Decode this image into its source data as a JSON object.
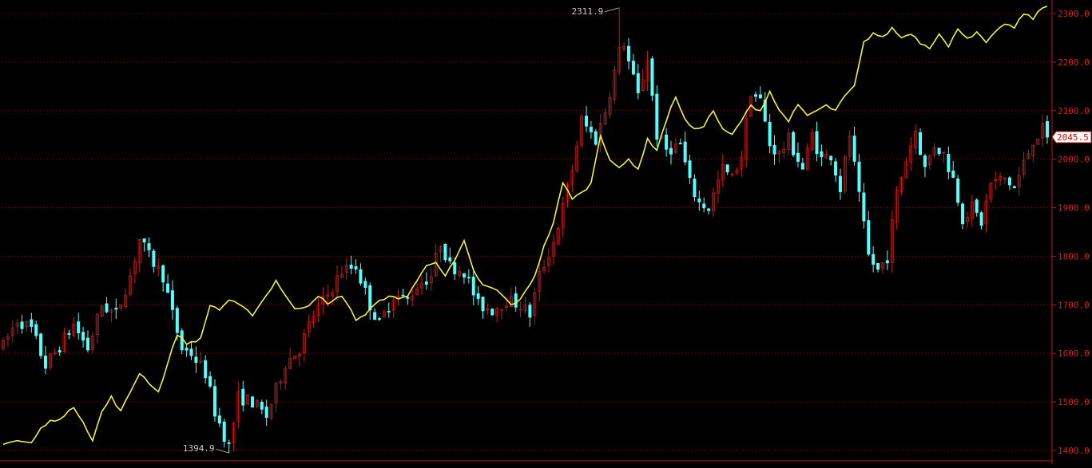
{
  "theme": {
    "background": "#000000",
    "grid_color": "#7a0f0f",
    "axis_color": "#c01515",
    "axis_text_color": "#d02020",
    "up_color": "#c01a1a",
    "down_color": "#54ffff",
    "line_color": "#f2f240",
    "label_color": "#c8c8c8",
    "current_box_bg": "#ffffff",
    "current_box_text": "#e00000"
  },
  "chart_data": {
    "type": "candlestick",
    "title": "",
    "ylim": [
      1385,
      2330
    ],
    "y_ticks": [
      {
        "value": 2300,
        "label": "2300.0"
      },
      {
        "value": 2200,
        "label": "2200.0"
      },
      {
        "value": 2100,
        "label": "2100.0"
      },
      {
        "value": 2000,
        "label": "2000.0"
      },
      {
        "value": 1900,
        "label": "1900.0"
      },
      {
        "value": 1800,
        "label": "1800.0"
      },
      {
        "value": 1700,
        "label": "1700.0"
      },
      {
        "value": 1600,
        "label": "1600.0"
      },
      {
        "value": 1500,
        "label": "1500.0"
      },
      {
        "value": 1400,
        "label": "1400.0"
      }
    ],
    "grid": true,
    "current_value": {
      "value": 2045.5,
      "label": "2045.5"
    },
    "max_annotation": {
      "label": "2311.9",
      "value": 2311.9,
      "bar_index": 131
    },
    "min_annotation": {
      "label": "1394.9",
      "value": 1394.9,
      "bar_index": 48
    },
    "price_keyframes": [
      [
        0,
        1615
      ],
      [
        3,
        1670
      ],
      [
        6,
        1650
      ],
      [
        9,
        1575
      ],
      [
        12,
        1615
      ],
      [
        15,
        1660
      ],
      [
        18,
        1610
      ],
      [
        21,
        1700
      ],
      [
        24,
        1680
      ],
      [
        27,
        1760
      ],
      [
        29,
        1835
      ],
      [
        31,
        1800
      ],
      [
        34,
        1760
      ],
      [
        36,
        1680
      ],
      [
        38,
        1610
      ],
      [
        40,
        1600
      ],
      [
        43,
        1560
      ],
      [
        45,
        1480
      ],
      [
        48,
        1408
      ],
      [
        50,
        1510
      ],
      [
        53,
        1500
      ],
      [
        56,
        1470
      ],
      [
        60,
        1580
      ],
      [
        63,
        1610
      ],
      [
        66,
        1680
      ],
      [
        69,
        1720
      ],
      [
        72,
        1770
      ],
      [
        75,
        1780
      ],
      [
        78,
        1700
      ],
      [
        80,
        1660
      ],
      [
        83,
        1720
      ],
      [
        86,
        1710
      ],
      [
        88,
        1740
      ],
      [
        91,
        1760
      ],
      [
        93,
        1830
      ],
      [
        95,
        1780
      ],
      [
        98,
        1770
      ],
      [
        101,
        1700
      ],
      [
        104,
        1690
      ],
      [
        107,
        1710
      ],
      [
        110,
        1700
      ],
      [
        112,
        1680
      ],
      [
        114,
        1760
      ],
      [
        117,
        1830
      ],
      [
        119,
        1900
      ],
      [
        121,
        1980
      ],
      [
        123,
        2080
      ],
      [
        126,
        2040
      ],
      [
        128,
        2100
      ],
      [
        130,
        2180
      ],
      [
        131,
        2280
      ],
      [
        133,
        2200
      ],
      [
        135,
        2130
      ],
      [
        137,
        2210
      ],
      [
        139,
        2050
      ],
      [
        141,
        2020
      ],
      [
        144,
        2030
      ],
      [
        146,
        1950
      ],
      [
        148,
        1910
      ],
      [
        150,
        1900
      ],
      [
        153,
        1980
      ],
      [
        155,
        1960
      ],
      [
        157,
        2010
      ],
      [
        159,
        2140
      ],
      [
        161,
        2120
      ],
      [
        163,
        2030
      ],
      [
        165,
        2010
      ],
      [
        167,
        2040
      ],
      [
        170,
        1980
      ],
      [
        172,
        2050
      ],
      [
        174,
        2000
      ],
      [
        176,
        2010
      ],
      [
        178,
        1940
      ],
      [
        180,
        2050
      ],
      [
        182,
        1920
      ],
      [
        184,
        1800
      ],
      [
        186,
        1770
      ],
      [
        188,
        1800
      ],
      [
        190,
        1930
      ],
      [
        192,
        2000
      ],
      [
        194,
        2060
      ],
      [
        196,
        1980
      ],
      [
        198,
        2030
      ],
      [
        200,
        2010
      ],
      [
        202,
        1960
      ],
      [
        204,
        1880
      ],
      [
        206,
        1900
      ],
      [
        208,
        1870
      ],
      [
        210,
        1950
      ],
      [
        213,
        1960
      ],
      [
        215,
        1940
      ],
      [
        217,
        1990
      ],
      [
        219,
        2040
      ],
      [
        221,
        2060
      ],
      [
        222,
        2045.5
      ]
    ],
    "line_keyframes": [
      [
        0,
        1415
      ],
      [
        3,
        1420
      ],
      [
        6,
        1415
      ],
      [
        8,
        1445
      ],
      [
        10,
        1460
      ],
      [
        13,
        1470
      ],
      [
        15,
        1490
      ],
      [
        17,
        1460
      ],
      [
        19,
        1420
      ],
      [
        21,
        1480
      ],
      [
        23,
        1510
      ],
      [
        25,
        1480
      ],
      [
        27,
        1520
      ],
      [
        29,
        1560
      ],
      [
        31,
        1540
      ],
      [
        33,
        1520
      ],
      [
        35,
        1580
      ],
      [
        37,
        1640
      ],
      [
        39,
        1620
      ],
      [
        42,
        1630
      ],
      [
        44,
        1700
      ],
      [
        46,
        1690
      ],
      [
        48,
        1710
      ],
      [
        50,
        1700
      ],
      [
        53,
        1680
      ],
      [
        56,
        1720
      ],
      [
        58,
        1750
      ],
      [
        60,
        1720
      ],
      [
        62,
        1690
      ],
      [
        65,
        1700
      ],
      [
        67,
        1720
      ],
      [
        69,
        1700
      ],
      [
        72,
        1720
      ],
      [
        75,
        1670
      ],
      [
        77,
        1680
      ],
      [
        79,
        1700
      ],
      [
        82,
        1720
      ],
      [
        84,
        1710
      ],
      [
        86,
        1720
      ],
      [
        88,
        1750
      ],
      [
        90,
        1780
      ],
      [
        92,
        1790
      ],
      [
        94,
        1760
      ],
      [
        96,
        1790
      ],
      [
        98,
        1830
      ],
      [
        100,
        1770
      ],
      [
        102,
        1740
      ],
      [
        105,
        1730
      ],
      [
        108,
        1700
      ],
      [
        110,
        1710
      ],
      [
        113,
        1760
      ],
      [
        115,
        1820
      ],
      [
        117,
        1870
      ],
      [
        119,
        1950
      ],
      [
        121,
        1920
      ],
      [
        123,
        1930
      ],
      [
        125,
        1950
      ],
      [
        127,
        2050
      ],
      [
        129,
        2000
      ],
      [
        131,
        1980
      ],
      [
        133,
        2000
      ],
      [
        135,
        1980
      ],
      [
        137,
        2040
      ],
      [
        139,
        2020
      ],
      [
        141,
        2080
      ],
      [
        143,
        2130
      ],
      [
        145,
        2080
      ],
      [
        147,
        2060
      ],
      [
        149,
        2070
      ],
      [
        151,
        2100
      ],
      [
        153,
        2060
      ],
      [
        155,
        2050
      ],
      [
        157,
        2080
      ],
      [
        159,
        2110
      ],
      [
        161,
        2100
      ],
      [
        163,
        2140
      ],
      [
        165,
        2100
      ],
      [
        167,
        2080
      ],
      [
        169,
        2110
      ],
      [
        171,
        2090
      ],
      [
        173,
        2100
      ],
      [
        175,
        2110
      ],
      [
        177,
        2100
      ],
      [
        179,
        2130
      ],
      [
        181,
        2150
      ],
      [
        183,
        2240
      ],
      [
        185,
        2260
      ],
      [
        187,
        2250
      ],
      [
        189,
        2270
      ],
      [
        191,
        2250
      ],
      [
        193,
        2260
      ],
      [
        195,
        2240
      ],
      [
        197,
        2230
      ],
      [
        199,
        2260
      ],
      [
        201,
        2230
      ],
      [
        203,
        2270
      ],
      [
        205,
        2250
      ],
      [
        207,
        2260
      ],
      [
        209,
        2240
      ],
      [
        211,
        2260
      ],
      [
        213,
        2280
      ],
      [
        215,
        2270
      ],
      [
        217,
        2300
      ],
      [
        219,
        2290
      ],
      [
        221,
        2312
      ],
      [
        222,
        2315
      ]
    ]
  }
}
